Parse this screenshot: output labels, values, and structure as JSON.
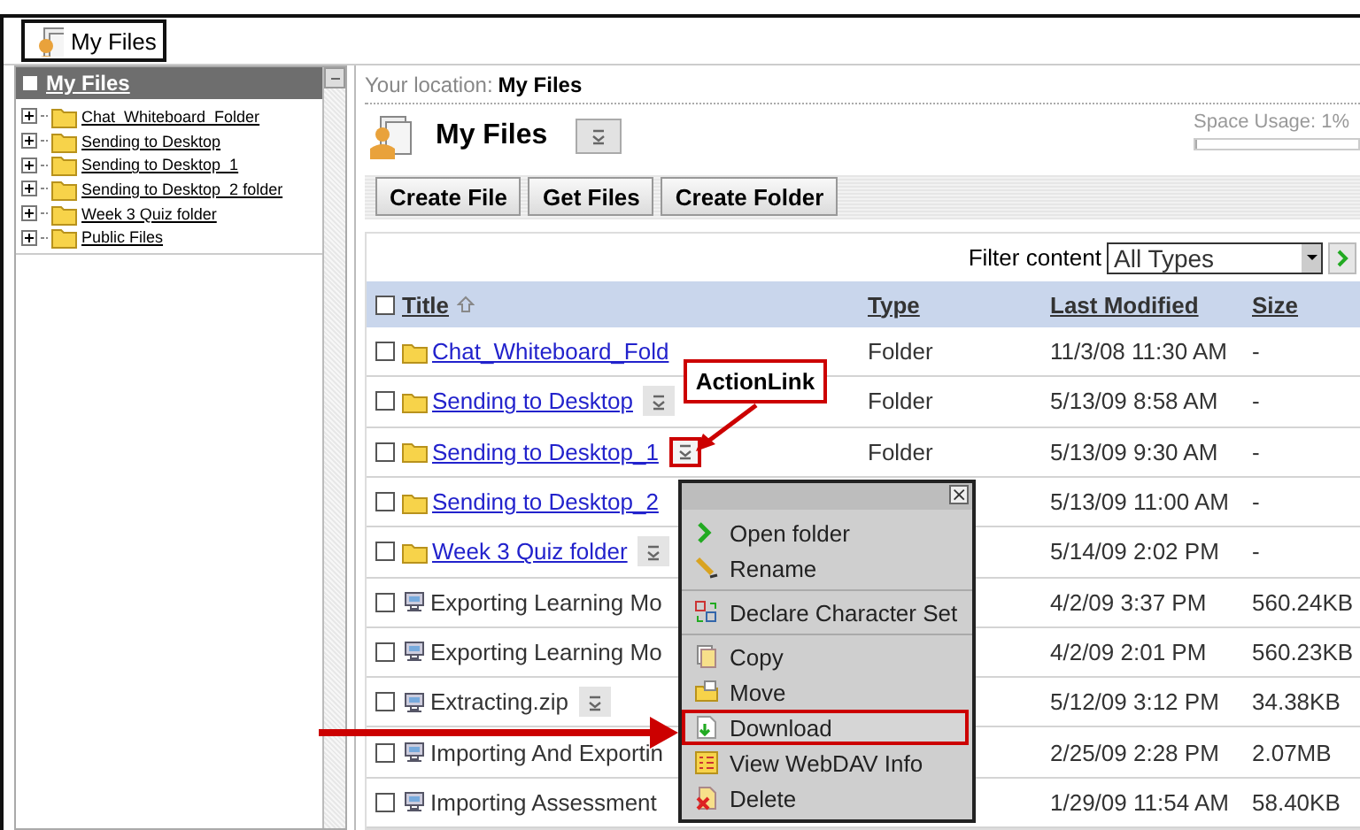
{
  "header": {
    "title": "My Files"
  },
  "sidebar": {
    "title": "My Files",
    "items": [
      {
        "label": "Chat_Whiteboard_Folder",
        "expanded": false
      },
      {
        "label": "Sending to Desktop",
        "expanded": false
      },
      {
        "label": "Sending to Desktop_1",
        "expanded": false
      },
      {
        "label": "Sending to Desktop_2 folder",
        "expanded": false
      },
      {
        "label": "Week 3 Quiz folder",
        "expanded": false
      },
      {
        "label": "Public Files",
        "expanded": false
      }
    ]
  },
  "location": {
    "label": "Your location:",
    "value": "My Files"
  },
  "page_title": "My Files",
  "space_usage": {
    "label": "Space Usage: 1%",
    "level": 0.01
  },
  "toolbar": [
    "Create File",
    "Get Files",
    "Create Folder"
  ],
  "filter": {
    "label": "Filter content",
    "value": "All Types"
  },
  "table": {
    "select_all_checked": false,
    "columns": [
      {
        "label": "Title",
        "sorted": true
      },
      {
        "label": "Type",
        "sorted": false
      },
      {
        "label": "Last Modified",
        "sorted": false
      },
      {
        "label": "Size",
        "sorted": false
      }
    ],
    "rows": [
      {
        "kind": "folder",
        "checked": false,
        "title": "Chat_Whiteboard_Fold",
        "action": false,
        "type": "Folder",
        "modified": "11/3/08 11:30 AM",
        "size": "-"
      },
      {
        "kind": "folder",
        "checked": false,
        "title": "Sending to Desktop",
        "action": true,
        "highlighted": false,
        "type": "Folder",
        "modified": "5/13/09 8:58 AM",
        "size": "-"
      },
      {
        "kind": "folder",
        "checked": false,
        "title": "Sending to Desktop_1",
        "action": true,
        "highlighted": true,
        "type": "Folder",
        "modified": "5/13/09 9:30 AM",
        "size": "-"
      },
      {
        "kind": "folder",
        "checked": false,
        "title": "Sending to Desktop_2",
        "action": false,
        "modified": "5/13/09 11:00 AM",
        "size": "-"
      },
      {
        "kind": "folder",
        "checked": false,
        "title": "Week 3 Quiz folder",
        "action": true,
        "highlighted": false,
        "modified": "5/14/09 2:02 PM",
        "size": "-"
      },
      {
        "kind": "file",
        "checked": false,
        "title": "Exporting Learning Mo",
        "action": false,
        "modified": "4/2/09 3:37 PM",
        "size": "560.24KB"
      },
      {
        "kind": "file",
        "checked": false,
        "title": "Exporting Learning Mo",
        "action": false,
        "modified": "4/2/09 2:01 PM",
        "size": "560.23KB"
      },
      {
        "kind": "file",
        "checked": false,
        "title": "Extracting.zip",
        "action": true,
        "highlighted": false,
        "modified": "5/12/09 3:12 PM",
        "size": "34.38KB"
      },
      {
        "kind": "file",
        "checked": false,
        "title": "Importing And Exportin",
        "action": false,
        "modified": "2/25/09 2:28 PM",
        "size": "2.07MB"
      },
      {
        "kind": "file",
        "checked": false,
        "title": "Importing Assessment",
        "action": false,
        "modified": "1/29/09 11:54 AM",
        "size": "58.40KB"
      }
    ]
  },
  "menu": {
    "close": "×",
    "items": [
      {
        "kind": "item",
        "label": "Open folder",
        "highlighted": false
      },
      {
        "kind": "item",
        "label": "Rename",
        "highlighted": false
      },
      {
        "kind": "separator"
      },
      {
        "kind": "item",
        "label": "Declare Character Set",
        "highlighted": false
      },
      {
        "kind": "separator"
      },
      {
        "kind": "item",
        "label": "Copy",
        "highlighted": false
      },
      {
        "kind": "item",
        "label": "Move",
        "highlighted": false
      },
      {
        "kind": "item",
        "label": "Download",
        "highlighted": true
      },
      {
        "kind": "item",
        "label": "View WebDAV Info",
        "highlighted": false
      },
      {
        "kind": "item",
        "label": "Delete",
        "highlighted": false
      }
    ]
  },
  "annotation": {
    "callout": "ActionLink"
  }
}
